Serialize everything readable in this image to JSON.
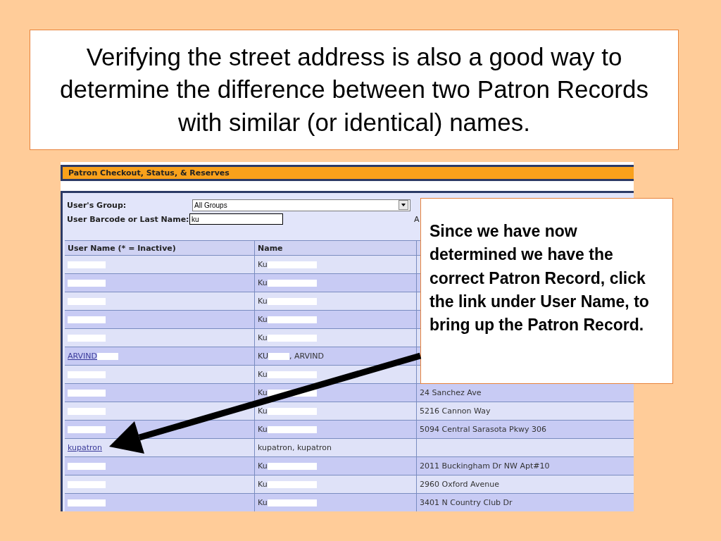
{
  "slide_title": "Verifying the street address is also a good way to determine the difference between two Patron Records with similar (or identical) names.",
  "screen": {
    "title": "Patron Checkout, Status, & Reserves",
    "form": {
      "group_label": "User's Group:",
      "group_value": "All Groups",
      "search_label": "User Barcode or Last Name:",
      "search_value": "ku",
      "column_3_label": "A"
    },
    "table": {
      "columns": [
        "User Name (* = Inactive)",
        "Name"
      ],
      "rows": [
        {
          "user": {
            "redacted": true
          },
          "name": {
            "visible": "Ku",
            "redacted": true
          }
        },
        {
          "user": {
            "redacted": true
          },
          "name": {
            "visible": "Ku",
            "redacted": true
          }
        },
        {
          "user": {
            "redacted": true
          },
          "name": {
            "visible": "Ku",
            "redacted": true
          }
        },
        {
          "user": {
            "redacted": true
          },
          "name": {
            "visible": "Ku",
            "redacted": true
          }
        },
        {
          "user": {
            "redacted": true
          },
          "name": {
            "visible": "Ku",
            "redacted": true
          }
        },
        {
          "user": {
            "visible": "ARVIND",
            "redacted": true
          },
          "name": {
            "visible": "KU",
            "redacted": true,
            "suffix": ", ARVIND"
          }
        },
        {
          "user": {
            "redacted": true
          },
          "name": {
            "visible": "Ku",
            "redacted": true
          }
        },
        {
          "user": {
            "redacted": true
          },
          "name": {
            "visible": "Ku",
            "redacted": true
          },
          "address": "24 Sanchez Ave"
        },
        {
          "user": {
            "redacted": true
          },
          "name": {
            "visible": "Ku",
            "redacted": true
          },
          "address": "5216 Cannon Way"
        },
        {
          "user": {
            "redacted": true
          },
          "name": {
            "visible": "Ku",
            "redacted": true
          },
          "address": "5094 Central Sarasota Pkwy 306"
        },
        {
          "user": {
            "visible": "kupatron",
            "redacted": false
          },
          "name": {
            "visible": "kupatron, kupatron",
            "redacted": false
          }
        },
        {
          "user": {
            "redacted": true
          },
          "name": {
            "visible": "Ku",
            "redacted": true
          },
          "address": "2011 Buckingham Dr NW Apt#10"
        },
        {
          "user": {
            "redacted": true
          },
          "name": {
            "visible": "Ku",
            "redacted": true
          },
          "address": "2960 Oxford Avenue"
        },
        {
          "user": {
            "redacted": true
          },
          "name": {
            "visible": "Ku",
            "redacted": true
          },
          "address": "3401 N Country Club Dr"
        }
      ]
    }
  },
  "callout": "Since we have now determined we have the correct Patron Record, click the link under User Name, to bring up the Patron Record."
}
